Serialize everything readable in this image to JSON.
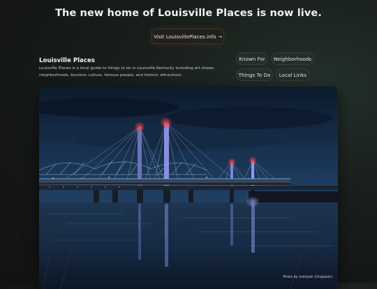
{
  "banner": {
    "headline": "The new home of Louisville Places is now live.",
    "cta_label": "Visit LouisvillePlaces.info →"
  },
  "intro": {
    "title": "Louisville Places",
    "description": "Louisville Places is a local guide to things to do in Louisville Kentucky including art shows, neighborhoods, bourbon culture, famous people, and historic attractions."
  },
  "nav_chips": [
    {
      "label": "Known For"
    },
    {
      "label": "Neighborhoods"
    },
    {
      "label": "Things To Do"
    },
    {
      "label": "Local Links"
    }
  ],
  "hero_photo": {
    "credit": "Photo by mstrjosh (Unsplash)"
  },
  "colors": {
    "accent_cta_bg": "#23201c",
    "chip_bg": "#262c29",
    "bridge_light_red": "#ff3a3a",
    "bridge_tower_blue": "#8a9cff"
  }
}
